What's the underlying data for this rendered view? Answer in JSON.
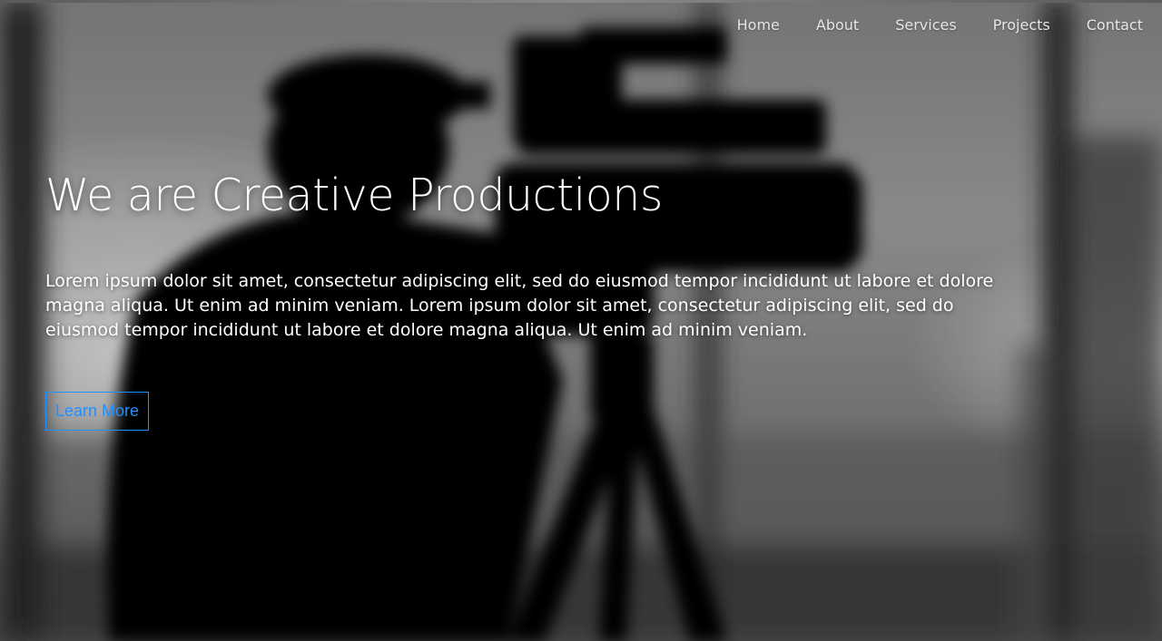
{
  "nav": {
    "items": [
      {
        "label": "Home"
      },
      {
        "label": "About"
      },
      {
        "label": "Services"
      },
      {
        "label": "Projects"
      },
      {
        "label": "Contact"
      }
    ]
  },
  "hero": {
    "title": "We are Creative Productions",
    "description": "Lorem ipsum dolor sit amet, consectetur adipiscing elit, sed do eiusmod tempor incididunt ut labore et dolore magna aliqua. Ut enim ad minim veniam. Lorem ipsum dolor sit amet, consectetur adipiscing elit, sed do eiusmod tempor incididunt ut labore et dolore magna aliqua. Ut enim ad minim veniam.",
    "cta_label": "Learn More",
    "background_image": "blurred-cameraman-silhouette-photo"
  },
  "colors": {
    "accent": "#1e90ff",
    "text": "#ffffff",
    "nav_text": "#e6e6e6"
  }
}
